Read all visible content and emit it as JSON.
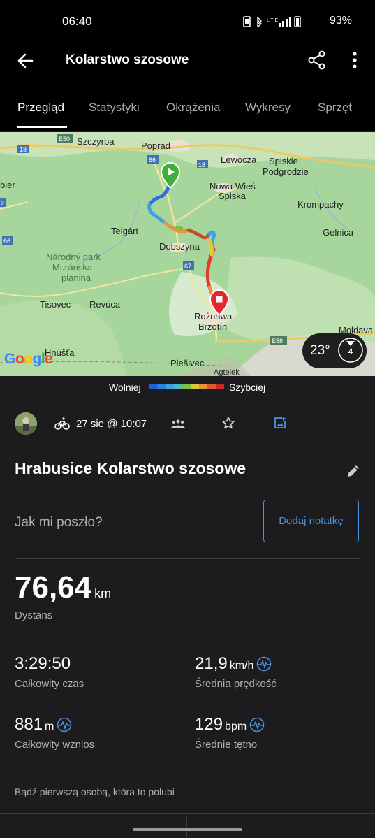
{
  "status_bar": {
    "time": "06:40",
    "network": "LTE",
    "battery": "93%"
  },
  "app_bar": {
    "title": "Kolarstwo szosowe"
  },
  "tabs": [
    {
      "label": "Przegląd",
      "active": true
    },
    {
      "label": "Statystyki",
      "active": false
    },
    {
      "label": "Okrążenia",
      "active": false
    },
    {
      "label": "Wykresy",
      "active": false
    },
    {
      "label": "Sprzęt",
      "active": false
    }
  ],
  "map": {
    "places": [
      "E50",
      "Szczyrba",
      "Poprad",
      "18",
      "66",
      "Lewocza",
      "Spiskie",
      "Podgrodzie",
      "18",
      "bier",
      "Nowa Wieś",
      "Spiska",
      "Krompachy",
      "2",
      "Telgárt",
      "Dobszyna",
      "Gelnica",
      "66",
      "Národný park",
      "Muránska",
      "planina",
      "67",
      "Tisovec",
      "Revúca",
      "Rożnawa",
      "Brzotín",
      "Moldava",
      "E58",
      "Hnúšťa",
      "Plešivec",
      "Agtelek"
    ],
    "attribution": "Google",
    "weather": {
      "temperature": "23°",
      "wind_speed": "4"
    }
  },
  "legend": {
    "slow_label": "Wolniej",
    "fast_label": "Szybciej"
  },
  "activity": {
    "date": "27 sie @ 10:07",
    "title": "Hrabusice Kolarstwo szosowe",
    "note_prompt": "Jak mi poszło?",
    "add_note_label": "Dodaj notatkę"
  },
  "stats": {
    "distance": {
      "value": "76,64",
      "unit": "km",
      "label": "Dystans"
    },
    "total_time": {
      "value": "3:29:50",
      "unit": "",
      "label": "Całkowity czas"
    },
    "avg_speed": {
      "value": "21,9",
      "unit": "km/h",
      "label": "Średnia prędkość"
    },
    "total_ascent": {
      "value": "881",
      "unit": "m",
      "label": "Całkowity wznios"
    },
    "avg_hr": {
      "value": "129",
      "unit": "bpm",
      "label": "Średnie tętno"
    }
  },
  "likes_text": "Bądź pierwszą osobą, która to polubi",
  "colors": {
    "accent": "#4a93e0",
    "start_marker": "#3fae3c",
    "end_marker": "#e8252c",
    "background": "#1c1c1e"
  },
  "icons": [
    "back-arrow-icon",
    "share-icon",
    "more-vert-icon",
    "bike-icon",
    "people-icon",
    "star-icon",
    "add-photo-icon",
    "edit-icon",
    "heart-wave-icon",
    "wind-direction-icon"
  ]
}
